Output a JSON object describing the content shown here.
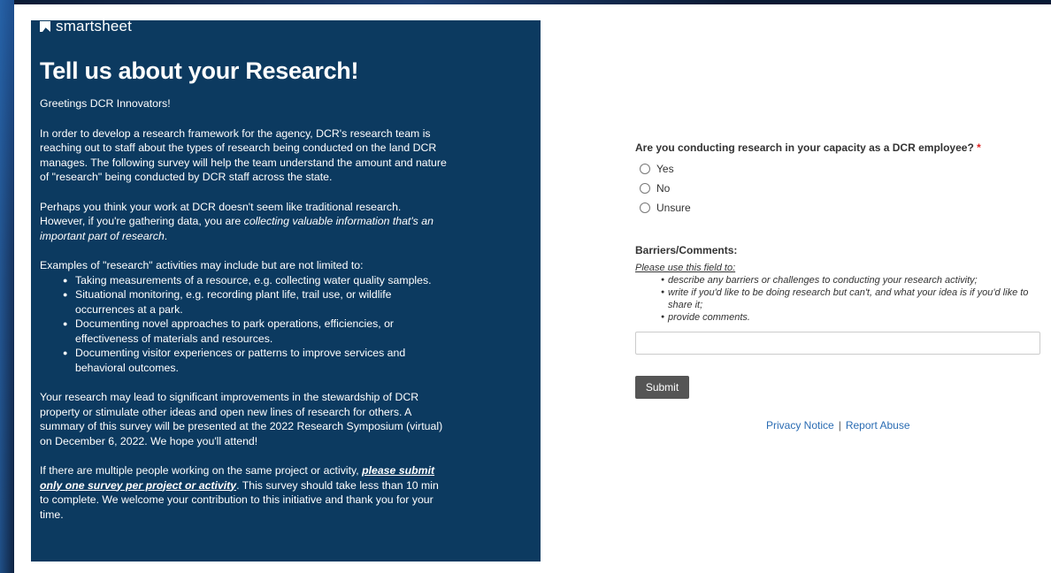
{
  "brand": {
    "name": "smartsheet"
  },
  "panel": {
    "title": "Tell us about your Research!",
    "greeting": "Greetings DCR Innovators!",
    "para1": "In order to develop a research framework for the agency, DCR's research team is reaching out to staff about the types of research being conducted on the land DCR manages. The following survey will help the team understand the amount and nature of \"research\" being conducted by DCR staff across the state.",
    "para2_plain": "Perhaps you think your work at DCR doesn't seem like traditional research. However, if you're gathering data, you are ",
    "para2_em": "collecting valuable information that's an important part of research",
    "para2_end": ".",
    "examples_intro": "Examples of \"research\" activities may include but are not limited to:",
    "examples": [
      "Taking measurements of a resource, e.g. collecting water quality samples.",
      "Situational monitoring, e.g. recording plant life, trail use, or wildlife occurrences at a park.",
      "Documenting novel approaches to park operations, efficiencies, or effectiveness of materials and resources.",
      "Documenting visitor experiences or patterns to improve services and behavioral outcomes."
    ],
    "para3": "Your research may lead to significant improvements in the stewardship of DCR property or stimulate other ideas and open new lines of research for others. A summary of this survey will be presented at the 2022 Research Symposium (virtual) on December 6, 2022. We hope you'll attend!",
    "para4_start": "If there are multiple people working on the same project or activity, ",
    "para4_link": "please submit only one survey per project or activity",
    "para4_end": ". This survey should take less than 10 min to complete. We welcome your contribution to this initiative and thank you for your time."
  },
  "form": {
    "question": "Are you conducting research in your capacity as a DCR employee?",
    "required_mark": "*",
    "options": [
      "Yes",
      "No",
      "Unsure"
    ],
    "barriers_label": "Barriers/Comments:",
    "help_title": "Please use this field to:",
    "help_items": [
      "describe any barriers or challenges to conducting your research activity;",
      "write if you'd like to be doing research but can't, and what your idea is if you'd like to share it;",
      "provide comments."
    ],
    "comment_value": "",
    "submit_label": "Submit"
  },
  "footer": {
    "privacy_label": "Privacy Notice",
    "separator": "|",
    "report_label": "Report Abuse"
  },
  "colors": {
    "panel_bg": "#0c3a60",
    "link": "#2a6cb3",
    "submit_bg": "#555555",
    "required": "#dd2222"
  }
}
